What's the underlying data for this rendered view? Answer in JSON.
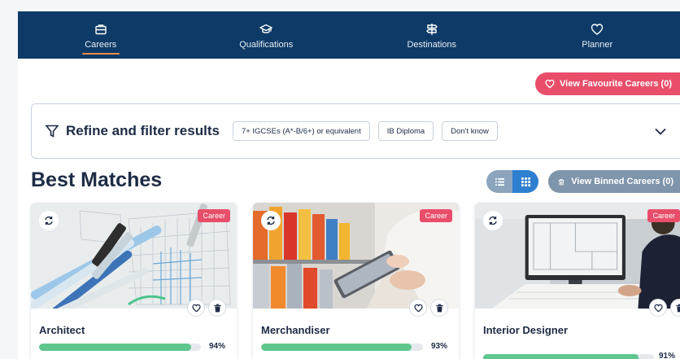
{
  "nav": {
    "items": [
      {
        "label": "Careers",
        "icon": "briefcase-icon",
        "active": true
      },
      {
        "label": "Qualifications",
        "icon": "graduation-cap-icon",
        "active": false
      },
      {
        "label": "Destinations",
        "icon": "signpost-icon",
        "active": false
      },
      {
        "label": "Planner",
        "icon": "heart-icon",
        "active": false
      }
    ]
  },
  "favourites": {
    "label": "View Favourite Careers (0)"
  },
  "filter": {
    "title": "Refine and filter results",
    "chips": [
      "7+ IGCSEs (A*-B/6+) or equivalent",
      "IB Diploma",
      "Don't know"
    ]
  },
  "section": {
    "title": "Best Matches"
  },
  "binned": {
    "label": "View Binned Careers (0)"
  },
  "colors": {
    "nav_bg": "#0d3a66",
    "accent_pink": "#e84e6a",
    "match_green": "#5fc68d",
    "active_underline": "#ef8a4a"
  },
  "cards": [
    {
      "title": "Architect",
      "badge": "Career",
      "match_pct": 94,
      "match_label": "94%"
    },
    {
      "title": "Merchandiser",
      "badge": "Career",
      "match_pct": 93,
      "match_label": "93%"
    },
    {
      "title": "Interior Designer",
      "badge": "Career",
      "match_pct": 91,
      "match_label": "91%"
    }
  ]
}
